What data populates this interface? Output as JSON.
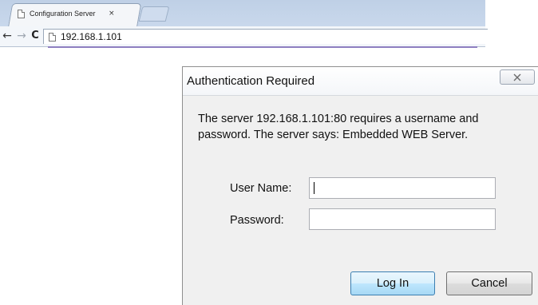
{
  "browser": {
    "tab_title": "Configuration Server",
    "tab_close": "×",
    "url": "192.168.1.101",
    "icons": {
      "back": "back-arrow-icon",
      "forward": "forward-arrow-icon",
      "reload": "reload-icon",
      "page": "page-icon"
    }
  },
  "dialog": {
    "title": "Authentication Required",
    "close_glyph": "☒",
    "message": "The server 192.168.1.101:80 requires a username and password. The server says: Embedded WEB Server.",
    "username_label": "User Name:",
    "username_value": "",
    "password_label": "Password:",
    "password_value": "",
    "login_button": "Log In",
    "cancel_button": "Cancel"
  }
}
